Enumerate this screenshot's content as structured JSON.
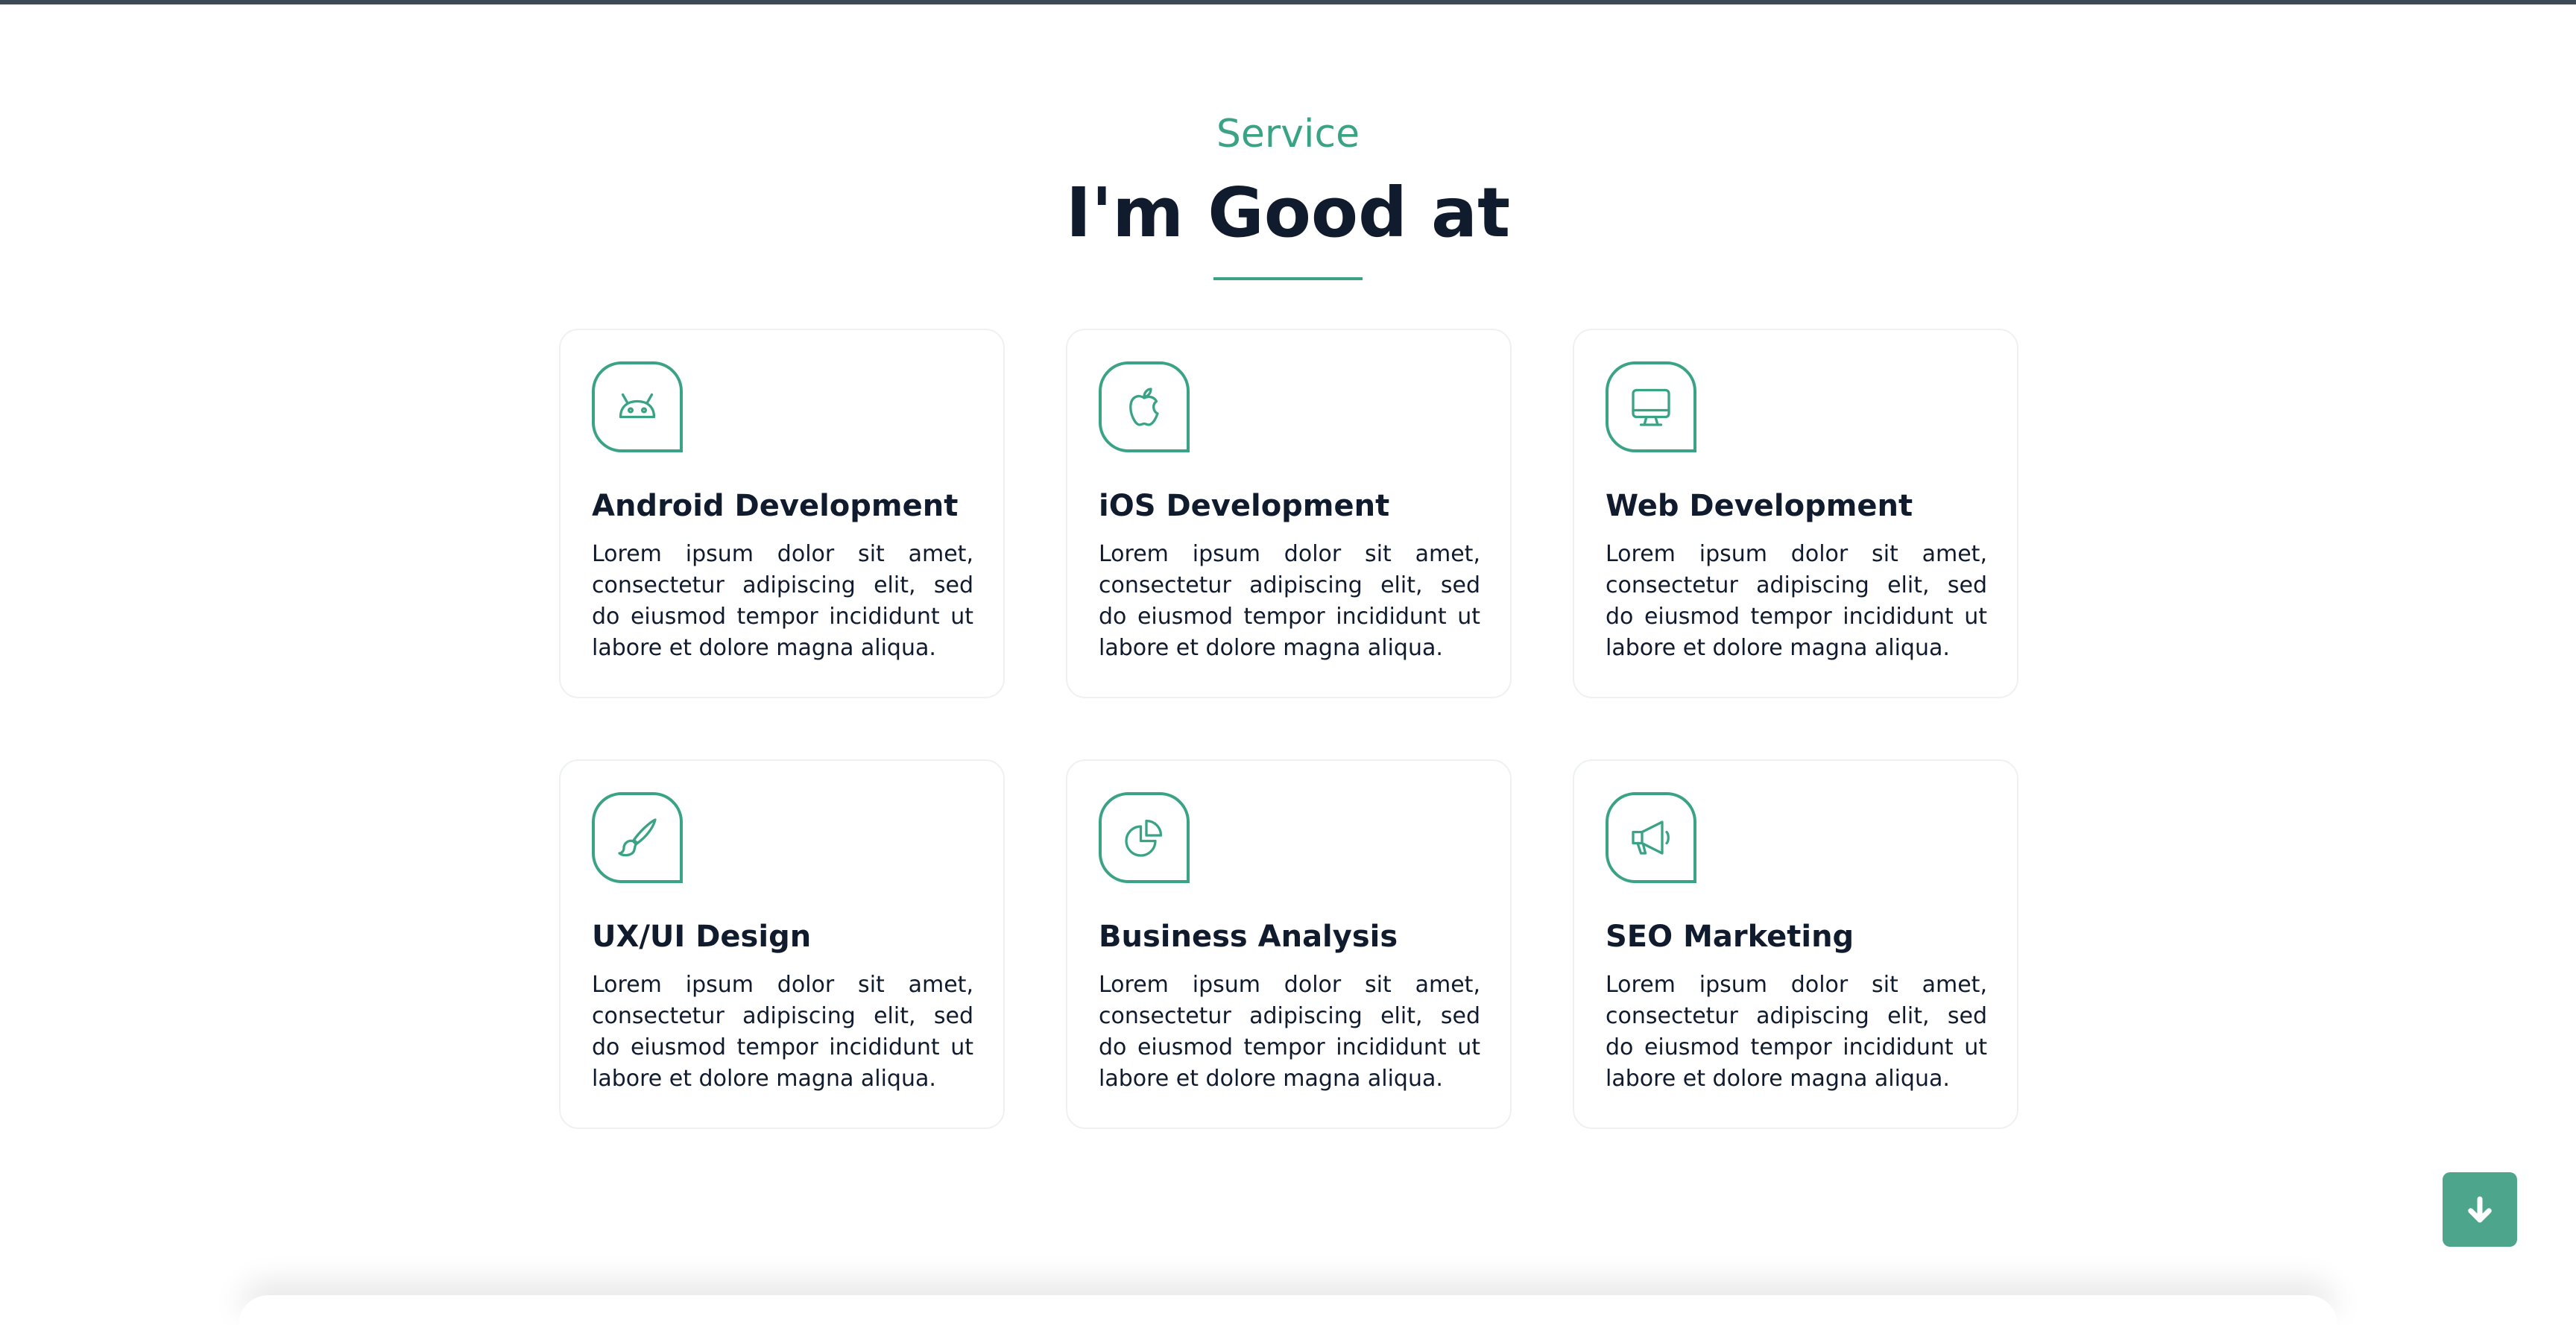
{
  "section": {
    "eyebrow": "Service",
    "heading": "I'm Good at"
  },
  "accent_color": "#3aa386",
  "heading_color": "#111b2e",
  "services": [
    {
      "icon": "android-icon",
      "title": "Android Development",
      "description": "Lorem ipsum dolor sit amet, consectetur adipiscing elit, sed do eiusmod tempor incididunt ut labore et dolore magna aliqua."
    },
    {
      "icon": "apple-icon",
      "title": "iOS Development",
      "description": "Lorem ipsum dolor sit amet, consectetur adipiscing elit, sed do eiusmod tempor incididunt ut labore et dolore magna aliqua."
    },
    {
      "icon": "monitor-icon",
      "title": "Web Development",
      "description": "Lorem ipsum dolor sit amet, consectetur adipiscing elit, sed do eiusmod tempor incididunt ut labore et dolore magna aliqua."
    },
    {
      "icon": "paintbrush-icon",
      "title": "UX/UI Design",
      "description": "Lorem ipsum dolor sit amet, consectetur adipiscing elit, sed do eiusmod tempor incididunt ut labore et dolore magna aliqua."
    },
    {
      "icon": "pie-chart-icon",
      "title": "Business Analysis",
      "description": "Lorem ipsum dolor sit amet, consectetur adipiscing elit, sed do eiusmod tempor incididunt ut labore et dolore magna aliqua."
    },
    {
      "icon": "megaphone-icon",
      "title": "SEO Marketing",
      "description": "Lorem ipsum dolor sit amet, consectetur adipiscing elit, sed do eiusmod tempor incididunt ut labore et dolore magna aliqua."
    }
  ],
  "scroll_button": {
    "icon": "arrow-down-icon"
  }
}
